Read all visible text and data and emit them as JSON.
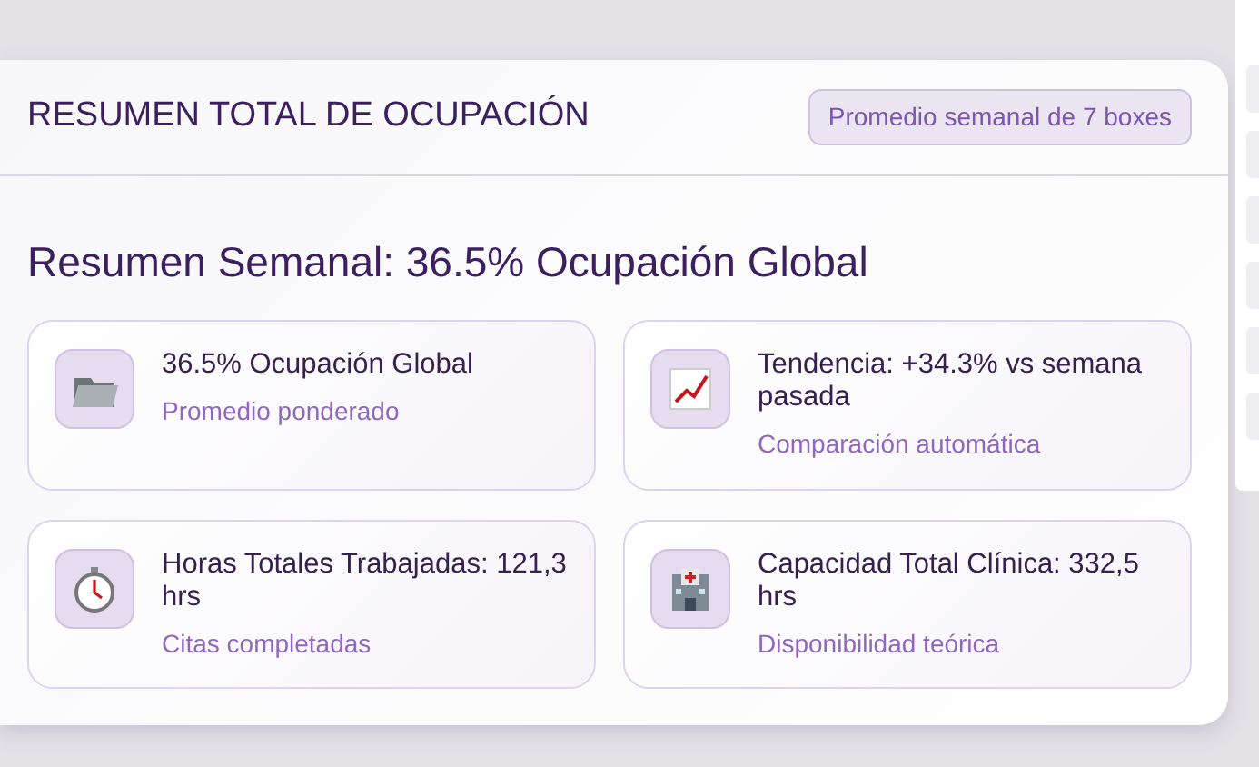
{
  "header": {
    "title": "RESUMEN TOTAL DE OCUPACIÓN",
    "badge": "Promedio semanal de 7 boxes"
  },
  "summary_title": "Resumen Semanal: 36.5% Ocupación Global",
  "stats": [
    {
      "kind": "folder",
      "title": "36.5% Ocupación Global",
      "subtitle": "Promedio ponderado"
    },
    {
      "kind": "trend",
      "title": "Tendencia: +34.3% vs semana pasada",
      "subtitle": "Comparación automática"
    },
    {
      "kind": "stopwatch",
      "title": "Horas Totales Trabajadas: 121,3 hrs",
      "subtitle": "Citas completadas"
    },
    {
      "kind": "hospital",
      "title": "Capacidad Total Clínica: 332,5 hrs",
      "subtitle": "Disponibilidad teórica"
    }
  ]
}
